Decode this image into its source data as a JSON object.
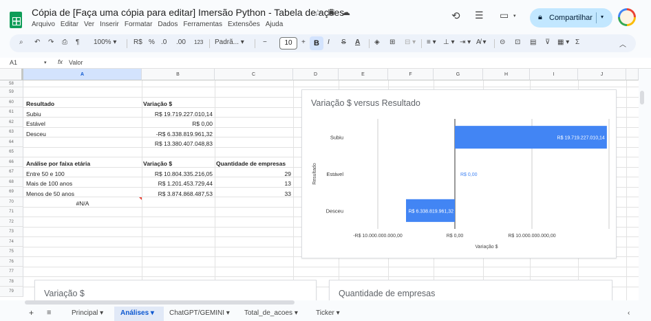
{
  "doc": {
    "title": "Cópia de [Faça uma cópia para editar] Imersão Python - Tabela de ações",
    "menu": [
      "Arquivo",
      "Editar",
      "Ver",
      "Inserir",
      "Formatar",
      "Dados",
      "Ferramentas",
      "Extensões",
      "Ajuda"
    ],
    "share_label": "Compartilhar"
  },
  "toolbar": {
    "zoom": "100%",
    "currency": "R$",
    "percent": "%",
    "dec_decrease": ".0",
    "dec_increase": ".00",
    "number_format": "123",
    "font": "Padrã...",
    "font_size": "10",
    "minus": "−",
    "plus": "+",
    "bold": "B",
    "italic": "I",
    "strike": "S",
    "text_color": "A",
    "sum": "Σ"
  },
  "formula_bar": {
    "cell_ref": "A1",
    "fx": "fx",
    "value": "Valor"
  },
  "columns": [
    "A",
    "B",
    "C",
    "D",
    "E",
    "F",
    "G",
    "H",
    "I",
    "J"
  ],
  "row_numbers": [
    "58",
    "59",
    "60",
    "61",
    "62",
    "63",
    "64",
    "65",
    "66",
    "67",
    "68",
    "69",
    "70",
    "71",
    "72",
    "73",
    "74",
    "75",
    "76",
    "77",
    "78",
    "79"
  ],
  "cells": {
    "r60a": "Resultado",
    "r60b": "Variação $",
    "r61a": "Subiu",
    "r61b": "R$ 19.719.227.010,14",
    "r62a": "Estável",
    "r62b": "R$ 0,00",
    "r63a": "Desceu",
    "r63b": "-R$ 6.338.819.961,32",
    "r64b": "R$ 13.380.407.048,83",
    "r66a": "Análise por faixa etária",
    "r66b": "Variação $",
    "r66c": "Quantidade de empresas",
    "r67a": "Entre 50 e 100",
    "r67b": "R$ 10.804.335.216,05",
    "r67c": "29",
    "r68a": "Mais de 100 anos",
    "r68b": "R$ 1.201.453.729,44",
    "r68c": "13",
    "r69a": "Menos de 50 anos",
    "r69b": "R$ 3.874.868.487,53",
    "r69c": "33",
    "r70a": "#N/A"
  },
  "charts": {
    "bottom_left_title": "Variação $",
    "bottom_right_title": "Quantidade de empresas"
  },
  "chart_data": {
    "type": "bar",
    "orientation": "horizontal",
    "title": "Variação $ versus Resultado",
    "xlabel": "Variação $",
    "ylabel": "Resultado",
    "categories": [
      "Subiu",
      "Estável",
      "Desceu"
    ],
    "values": [
      19719227010.14,
      0,
      -6338819961.32
    ],
    "data_labels": [
      "R$ 19.719.227.010,14",
      "R$ 0,00",
      "R$ 6.338.819.961,32"
    ],
    "xlim": [
      -10000000000,
      20000000000
    ],
    "xticks": [
      -10000000000,
      0,
      10000000000
    ],
    "xtick_labels": [
      "-R$ 10.000.000.000,00",
      "R$ 0,00",
      "R$ 10.000.000.000,00"
    ],
    "grid": true,
    "bar_color": "#4285f4"
  },
  "tabs": [
    "Principal",
    "Análises",
    "ChatGPT/GEMINI",
    "Total_de_acoes",
    "Ticker"
  ],
  "active_tab": "Análises",
  "colors": {
    "accent": "#0b57d0",
    "share_bg": "#c2e7ff",
    "bar": "#4285f4"
  }
}
